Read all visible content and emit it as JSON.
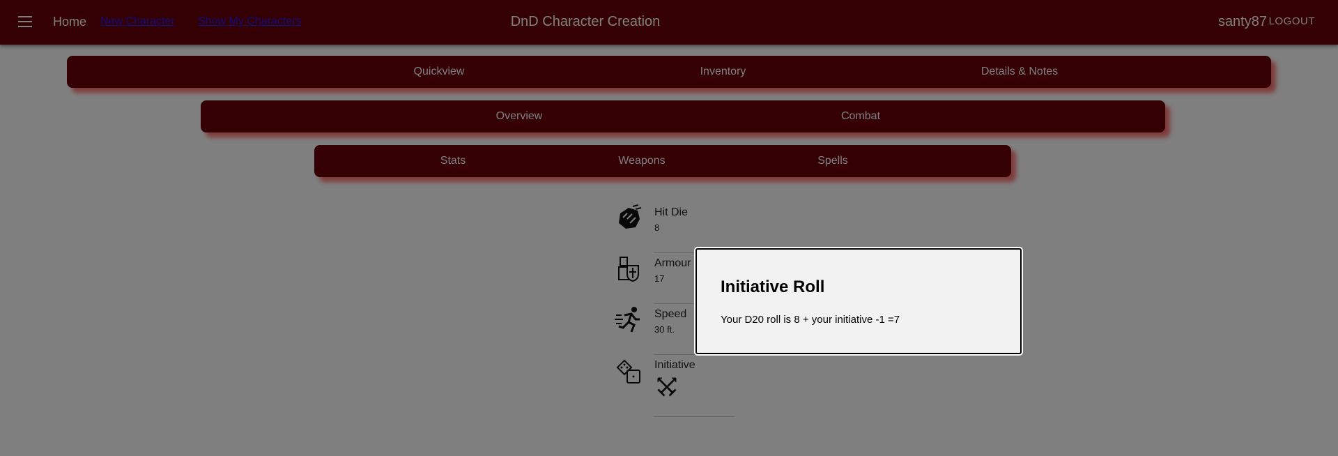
{
  "appbar": {
    "home": "Home",
    "new_character": "New Character",
    "show_characters": "Show My Characters",
    "title": "DnD Character Creation",
    "username": "santy87",
    "logout": "LOGOUT"
  },
  "tabs_primary": [
    "Quickview",
    "Inventory",
    "Details & Notes"
  ],
  "tabs_secondary": [
    "Overview",
    "Combat"
  ],
  "tabs_tertiary": [
    "Stats",
    "Weapons",
    "Spells"
  ],
  "stats": [
    {
      "name": "Hit Die",
      "value": "8",
      "icon": "hit-die-fist-icon"
    },
    {
      "name": "Armour Class",
      "value": "17",
      "icon": "knight-shield-icon"
    },
    {
      "name": "Speed",
      "value": "30 ft.",
      "icon": "running-man-icon"
    },
    {
      "name": "Initiative",
      "value": "",
      "icon": "dice-icon",
      "action_icon": "crossed-swords-icon"
    }
  ],
  "dialog": {
    "title": "Initiative Roll",
    "body": "Your D20 roll is 8 + your initiative -1 =7"
  },
  "colors": {
    "appbar": "#6a0008",
    "tab_shadow": "#ff0000",
    "overlay": "rgba(0,0,0,0.5)"
  }
}
